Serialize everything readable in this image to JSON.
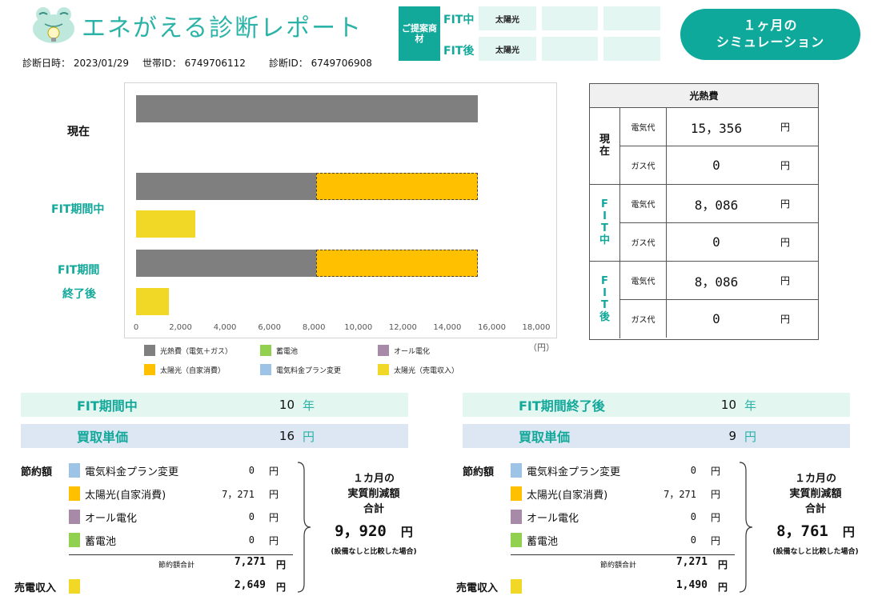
{
  "header": {
    "app_title": "エネがえる診断レポート",
    "logo_icon": "frog-lightbulb-icon",
    "diagnosis_datetime": "診断日時： 2023/01/29",
    "household_id": "世帯ID： 6749706112",
    "diagnosis_id": "診断ID： 6749706908"
  },
  "proposal": {
    "label": "ご提案商材",
    "rows": [
      {
        "label": "FIT中",
        "cells": [
          "太陽光",
          "",
          "",
          ""
        ]
      },
      {
        "label": "FIT後",
        "cells": [
          "太陽光",
          "",
          "",
          ""
        ]
      }
    ]
  },
  "simulation_button": {
    "label": "１ヶ月の\nシミュレーション"
  },
  "chart_data": {
    "type": "bar",
    "orientation": "horizontal",
    "stacked": true,
    "categories": [
      "現在",
      "FIT期間中",
      "FIT期間終了後"
    ],
    "category_display": {
      "current": "現在",
      "fit_during": "FIT期間中",
      "fit_after_1": "FIT期間",
      "fit_after_2": "終了後"
    },
    "series": [
      {
        "name": "光熱費（電気＋ガス）",
        "color": "#7f7f7f",
        "values": [
          15356,
          8086,
          8086
        ]
      },
      {
        "name": "太陽光（自家消費）",
        "color": "#ffc000",
        "values": [
          0,
          7271,
          7271
        ]
      },
      {
        "name": "太陽光（売電収入）",
        "color": "#f2d826",
        "values": [
          0,
          2649,
          1490
        ]
      },
      {
        "name": "蓄電池",
        "color": "#92d050",
        "values": [
          0,
          0,
          0
        ]
      },
      {
        "name": "電気料金プラン変更",
        "color": "#9dc3e6",
        "values": [
          0,
          0,
          0
        ]
      },
      {
        "name": "オール電化",
        "color": "#a68aa8",
        "values": [
          0,
          0,
          0
        ]
      }
    ],
    "xlim": [
      0,
      18000
    ],
    "x_ticks": [
      "0",
      "2,000",
      "4,000",
      "6,000",
      "8,000",
      "10,000",
      "12,000",
      "14,000",
      "16,000",
      "18,000"
    ],
    "unit_label": "（円）",
    "legend_placement": "bottom",
    "legend": [
      {
        "label": "光熱費（電気＋ガス）",
        "color": "#7f7f7f"
      },
      {
        "label": "蓄電池",
        "color": "#92d050"
      },
      {
        "label": "オール電化",
        "color": "#a68aa8"
      },
      {
        "label": "太陽光（自家消費）",
        "color": "#ffc000"
      },
      {
        "label": "電気料金プラン変更",
        "color": "#9dc3e6"
      },
      {
        "label": "太陽光（売電収入）",
        "color": "#f2d826"
      }
    ]
  },
  "cost_table": {
    "title": "光熱費",
    "groups": [
      {
        "label": "現\n在",
        "electric_label": "電気代",
        "electric": "15，356",
        "gas_label": "ガス代",
        "gas": "0",
        "unit": "円"
      },
      {
        "label": "F\nI\nT\n中",
        "electric_label": "電気代",
        "electric": "8，086",
        "gas_label": "ガス代",
        "gas": "0",
        "unit": "円"
      },
      {
        "label": "F\nI\nT\n後",
        "electric_label": "電気代",
        "electric": "8，086",
        "gas_label": "ガス代",
        "gas": "0",
        "unit": "円"
      }
    ]
  },
  "panels": [
    {
      "period_label": "FIT期間中",
      "period_value": "10",
      "period_unit": "年",
      "price_label": "買取単価",
      "price_value": "16",
      "price_unit": "円",
      "savings_title": "節約額",
      "savings": [
        {
          "name": "電気料金プラン変更",
          "value": "0",
          "unit": "円",
          "color": "#9dc3e6"
        },
        {
          "name": "太陽光(自家消費)",
          "value": "7，271",
          "unit": "円",
          "color": "#ffc000"
        },
        {
          "name": "オール電化",
          "value": "0",
          "unit": "円",
          "color": "#a68aa8"
        },
        {
          "name": "蓄電池",
          "value": "0",
          "unit": "円",
          "color": "#92d050"
        }
      ],
      "sum_label": "節約額合計",
      "sum_value": "7,271",
      "sum_unit": "円",
      "sales_label": "売電収入",
      "sales_value": "2,649",
      "sales_unit": "円",
      "sales_color": "#f2d826",
      "total_title": "１カ月の\n実質削減額\n合計",
      "total_value": "9，920",
      "total_unit": "円",
      "total_note": "(設備なしと比較した場合)"
    },
    {
      "period_label": "FIT期間終了後",
      "period_value": "10",
      "period_unit": "年",
      "price_label": "買取単価",
      "price_value": "9",
      "price_unit": "円",
      "savings_title": "節約額",
      "savings": [
        {
          "name": "電気料金プラン変更",
          "value": "0",
          "unit": "円",
          "color": "#9dc3e6"
        },
        {
          "name": "太陽光(自家消費)",
          "value": "7，271",
          "unit": "円",
          "color": "#ffc000"
        },
        {
          "name": "オール電化",
          "value": "0",
          "unit": "円",
          "color": "#a68aa8"
        },
        {
          "name": "蓄電池",
          "value": "0",
          "unit": "円",
          "color": "#92d050"
        }
      ],
      "sum_label": "節約額合計",
      "sum_value": "7,271",
      "sum_unit": "円",
      "sales_label": "売電収入",
      "sales_value": "1,490",
      "sales_unit": "円",
      "sales_color": "#f2d826",
      "total_title": "１カ月の\n実質削減額\n合計",
      "total_value": "8，761",
      "total_unit": "円",
      "total_note": "(設備なしと比較した場合)"
    }
  ]
}
